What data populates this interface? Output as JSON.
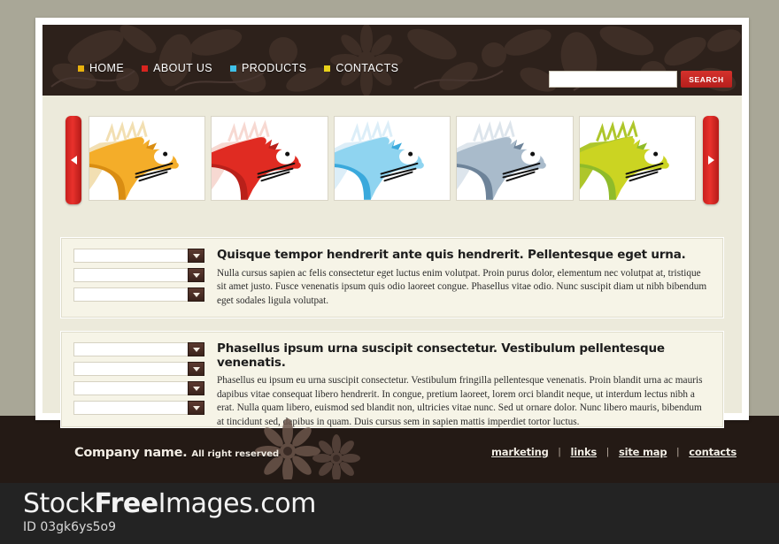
{
  "site": {
    "nav": [
      {
        "label": "HOME",
        "bullet": "#e8b10d"
      },
      {
        "label": "ABOUT US",
        "bullet": "#d8241f"
      },
      {
        "label": "PRODUCTS",
        "bullet": "#3fc0e8"
      },
      {
        "label": "CONTACTS",
        "bullet": "#e8d11a"
      }
    ],
    "search": {
      "value": "",
      "placeholder": "",
      "button_label": "SEARCH"
    }
  },
  "carousel": {
    "prev_label": "Previous",
    "next_label": "Next",
    "slides": [
      {
        "name": "dragon-head-orange",
        "body": "#f4ad29",
        "shade": "#d98d12",
        "mane": "#f2dfb2"
      },
      {
        "name": "dragon-head-red",
        "body": "#e02b22",
        "shade": "#b9201a",
        "mane": "#f7d9d2"
      },
      {
        "name": "dragon-head-blue",
        "body": "#8fd4f0",
        "shade": "#3aa9dc",
        "mane": "#dceef8"
      },
      {
        "name": "dragon-head-slate",
        "body": "#a9bbcb",
        "shade": "#6d8399",
        "mane": "#dde5ec"
      },
      {
        "name": "dragon-head-lime",
        "body": "#cbd422",
        "shade": "#8fbb2a",
        "mane": "#e3e89a"
      }
    ]
  },
  "panels": [
    {
      "heading": "Quisque tempor hendrerit ante quis hendrerit. Pellentesque eget urna.",
      "body": "Nulla cursus sapien ac felis consectetur eget luctus enim volutpat. Proin purus dolor, elementum nec volutpat at, tristique sit amet justo. Fusce venenatis ipsum quis odio laoreet congue. Phasellus vitae odio. Nunc suscipit diam ut nibh bibendum eget sodales ligula volutpat.",
      "selects": [
        {
          "value": ""
        },
        {
          "value": ""
        },
        {
          "value": ""
        }
      ]
    },
    {
      "heading": "Phasellus ipsum urna suscipit consectetur. Vestibulum pellentesque venenatis.",
      "body": "Phasellus eu ipsum eu urna suscipit consectetur. Vestibulum fringilla pellentesque venenatis. Proin blandit urna ac mauris dapibus vitae consequat libero hendrerit. In congue, pretium laoreet, lorem orci blandit neque, ut interdum lectus nibh a erat. Nulla quam libero, euismod sed blandit non, ultricies vitae nunc. Sed ut ornare dolor. Nunc libero mauris, bibendum at tincidunt sed, dapibus in quam. Duis cursus sem in sapien mattis imperdiet tortor luctus.",
      "selects": [
        {
          "value": ""
        },
        {
          "value": ""
        },
        {
          "value": ""
        },
        {
          "value": ""
        }
      ]
    }
  ],
  "footer": {
    "company_name": "Company name.",
    "rights": "All right reserved",
    "separator": "|",
    "links": [
      {
        "label": "marketing"
      },
      {
        "label": "links"
      },
      {
        "label": "site map"
      },
      {
        "label": "contacts"
      }
    ]
  },
  "watermark": {
    "brand_pre": "Stock",
    "brand_mid": "Free",
    "brand_post": "Images.com",
    "id": "ID 03gk6ys5o9"
  },
  "colors": {
    "page_background": "#a9a797",
    "header_dark": "#2d211b",
    "footer_dark": "#241a15",
    "panel_cream": "#f6f4e7",
    "accent_red": "#d4322c",
    "watermark_bg": "#232323"
  }
}
